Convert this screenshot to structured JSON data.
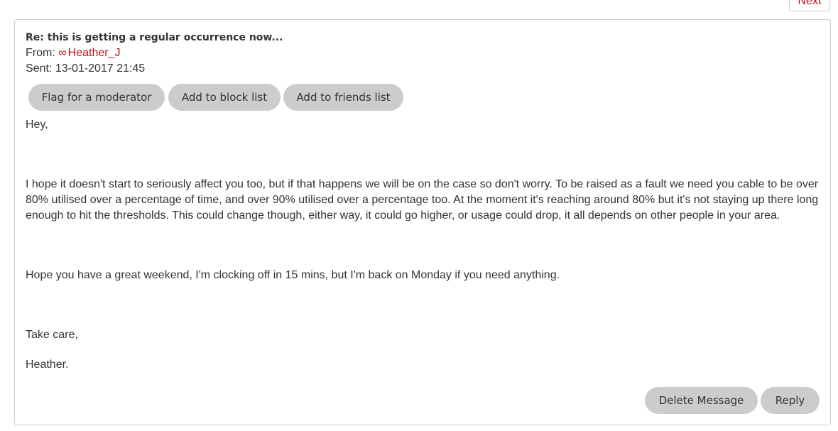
{
  "nav": {
    "next_label": "Next"
  },
  "message": {
    "subject": "Re: this is getting a regular occurrence now...",
    "from_label": "From:",
    "sender_name": "Heather_J",
    "sender_icon": "infinity-icon",
    "sent_label": "Sent:",
    "sent_value": "13-01-2017 21:45",
    "actions": {
      "flag": "Flag for a moderator",
      "block": "Add to block list",
      "friends": "Add to friends list"
    },
    "body": {
      "greeting": "Hey,",
      "main": "I hope it doesn't start to seriously affect you too, but if that happens we will be on the case so don't worry. To be raised as a fault we need you cable to be over 80% utilised over a percentage of time, and over 90% utilised over a percentage too. At the moment it's reaching around 80% but it's not staying up there long enough to hit the thresholds. This could change though, either way, it could go higher, or usage could drop, it all depends on other people in your area.",
      "weekend": "Hope you have a great weekend, I'm clocking off in 15 mins, but I'm back on Monday if you need anything.",
      "take_care": "Take care,",
      "signoff": "Heather."
    },
    "footer_actions": {
      "delete": "Delete Message",
      "reply": "Reply"
    }
  },
  "colors": {
    "accent": "#c20e1a",
    "button_bg": "#cccccc",
    "text": "#333333",
    "border": "#cfcfcf"
  }
}
